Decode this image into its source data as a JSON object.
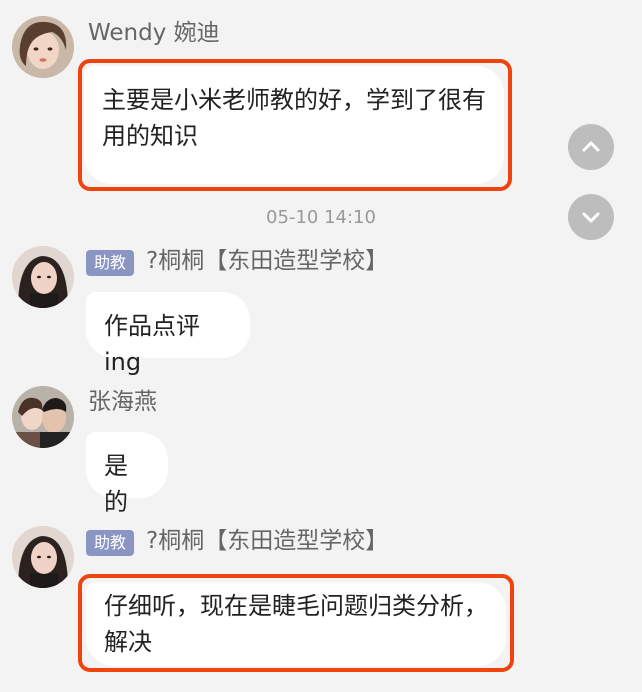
{
  "messages": [
    {
      "sender": "Wendy 婉迪",
      "badge": "",
      "text": "主要是小米老师教的好，学到了很有用的知识",
      "highlighted": true
    },
    {
      "sender": "?桐桐【东田造型学校】",
      "badge": "助教",
      "text": "作品点评ing",
      "highlighted": false
    },
    {
      "sender": "张海燕",
      "badge": "",
      "text": "是的",
      "highlighted": false
    },
    {
      "sender": "?桐桐【东田造型学校】",
      "badge": "助教",
      "text": "仔细听，现在是睫毛问题归类分析，解决",
      "highlighted": true
    }
  ],
  "timestamp": "05-10 14:10",
  "scroll_controls": {
    "up_icon": "chevron-up-icon",
    "down_icon": "chevron-down-icon"
  },
  "colors": {
    "highlight": "#f0440f",
    "badge": "#8a95c4",
    "background": "#f3f3f3"
  }
}
